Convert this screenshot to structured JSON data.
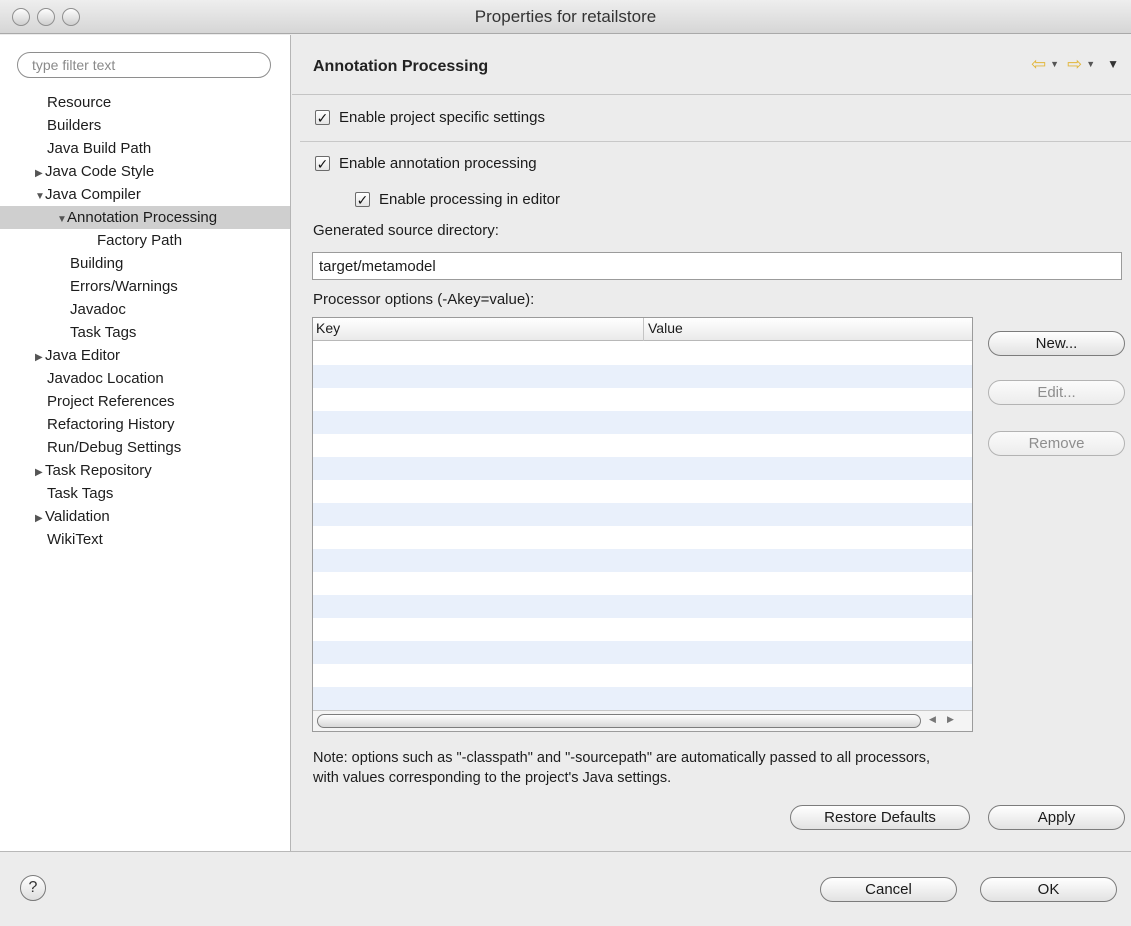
{
  "window": {
    "title": "Properties for retailstore"
  },
  "sidebar": {
    "filter_placeholder": "type filter text",
    "items": [
      {
        "label": "Resource",
        "arrow": ""
      },
      {
        "label": "Builders",
        "arrow": ""
      },
      {
        "label": "Java Build Path",
        "arrow": ""
      },
      {
        "label": "Java Code Style",
        "arrow": "▶"
      },
      {
        "label": "Java Compiler",
        "arrow": "▼"
      },
      {
        "label": "Annotation Processing",
        "arrow": "▼"
      },
      {
        "label": "Factory Path",
        "arrow": ""
      },
      {
        "label": "Building",
        "arrow": ""
      },
      {
        "label": "Errors/Warnings",
        "arrow": ""
      },
      {
        "label": "Javadoc",
        "arrow": ""
      },
      {
        "label": "Task Tags",
        "arrow": ""
      },
      {
        "label": "Java Editor",
        "arrow": "▶"
      },
      {
        "label": "Javadoc Location",
        "arrow": ""
      },
      {
        "label": "Project References",
        "arrow": ""
      },
      {
        "label": "Refactoring History",
        "arrow": ""
      },
      {
        "label": "Run/Debug Settings",
        "arrow": ""
      },
      {
        "label": "Task Repository",
        "arrow": "▶"
      },
      {
        "label": "Task Tags",
        "arrow": ""
      },
      {
        "label": "Validation",
        "arrow": "▶"
      },
      {
        "label": "WikiText",
        "arrow": ""
      }
    ]
  },
  "page": {
    "title": "Annotation Processing",
    "nav": {
      "back_icon": "back-arrow-icon",
      "forward_icon": "forward-arrow-icon",
      "menu_icon": "view-menu-icon"
    },
    "enable_project_specific": {
      "label": "Enable project specific settings",
      "checked": true
    },
    "enable_annotation_processing": {
      "label": "Enable annotation processing",
      "checked": true
    },
    "enable_processing_in_editor": {
      "label": "Enable processing in editor",
      "checked": true
    },
    "generated_source_label": "Generated source directory:",
    "generated_source_value": "target/metamodel",
    "processor_options_label": "Processor options (-Akey=value):",
    "table": {
      "columns": [
        "Key",
        "Value"
      ],
      "rows": []
    },
    "buttons": {
      "new": "New...",
      "edit": "Edit...",
      "remove": "Remove"
    },
    "note_line1": "Note: options such as \"-classpath\" and \"-sourcepath\" are automatically passed to all processors,",
    "note_line2": "with values corresponding to the project's Java settings.",
    "restore_defaults": "Restore Defaults",
    "apply": "Apply"
  },
  "footer": {
    "help_icon": "help-icon",
    "help_glyph": "?",
    "cancel": "Cancel",
    "ok": "OK"
  }
}
